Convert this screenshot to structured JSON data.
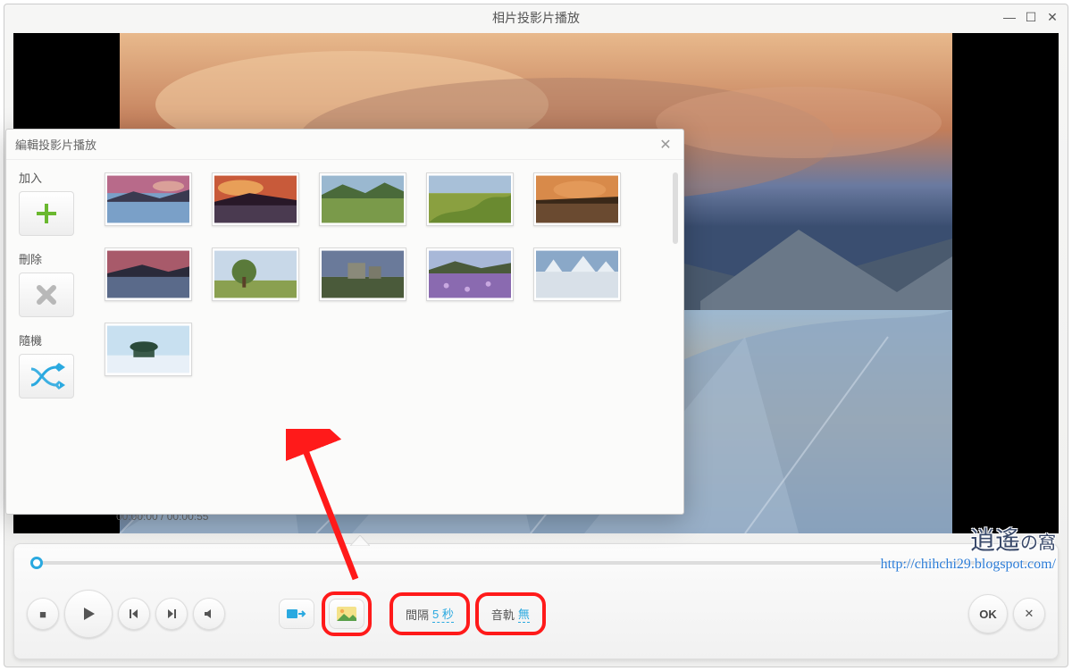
{
  "window": {
    "title": "相片投影片播放"
  },
  "dialog": {
    "title": "編輯投影片播放",
    "add_label": "加入",
    "delete_label": "刪除",
    "shuffle_label": "隨機"
  },
  "player": {
    "time_current": "00:00:00",
    "time_total": "00:00:55",
    "interval_label": "間隔",
    "interval_value": "5 秒",
    "audio_label": "音軌",
    "audio_value": "無",
    "ok_label": "OK"
  },
  "watermark": {
    "text_main": "逍遙",
    "text_small": "の窩",
    "url": "http://chihchi29.blogspot.com/"
  }
}
